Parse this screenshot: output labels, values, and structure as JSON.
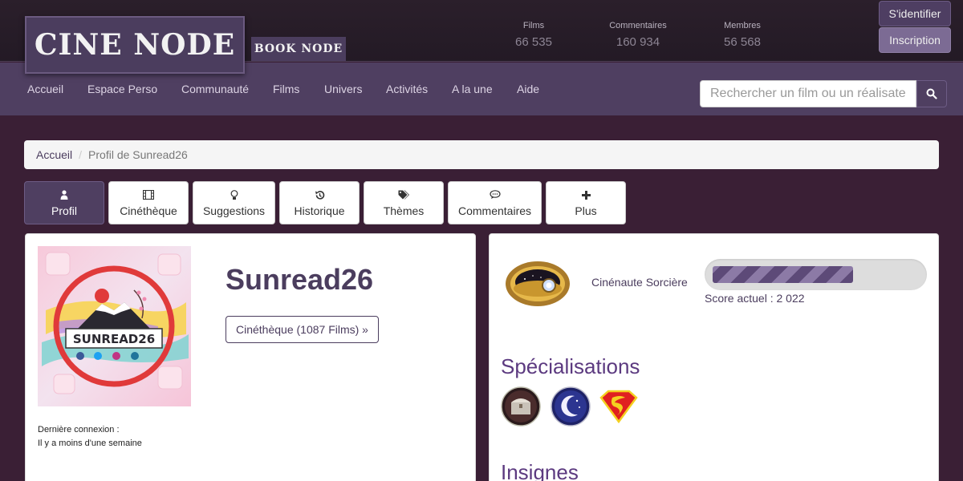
{
  "header": {
    "logo_main": "CINE NODE",
    "logo_secondary": "BOOK NODE",
    "stats": [
      {
        "label": "Films",
        "value": "66 535"
      },
      {
        "label": "Commentaires",
        "value": "160 934"
      },
      {
        "label": "Membres",
        "value": "56 568"
      }
    ],
    "login_label": "S'identifier",
    "signup_label": "Inscription"
  },
  "nav": {
    "items": [
      "Accueil",
      "Espace Perso",
      "Communauté",
      "Films",
      "Univers",
      "Activités",
      "A la une",
      "Aide"
    ],
    "search_placeholder": "Rechercher un film ou un réalisateur"
  },
  "breadcrumb": {
    "home": "Accueil",
    "current": "Profil de Sunread26"
  },
  "tabs": [
    {
      "label": "Profil",
      "icon": "user-icon"
    },
    {
      "label": "Cinéthèque",
      "icon": "film-icon"
    },
    {
      "label": "Suggestions",
      "icon": "lightbulb-icon"
    },
    {
      "label": "Historique",
      "icon": "history-icon"
    },
    {
      "label": "Thèmes",
      "icon": "tags-icon"
    },
    {
      "label": "Commentaires",
      "icon": "comment-icon"
    },
    {
      "label": "Plus",
      "icon": "plus-icon"
    }
  ],
  "profile": {
    "avatar_text": "SUNREAD26",
    "username": "Sunread26",
    "cinetheque_label": "Cinéthèque (1087 Films) »",
    "last_connection_label": "Dernière connexion :",
    "last_connection_value": "Il y a moins d'une semaine"
  },
  "rank": {
    "name": "Cinénaute Sorcière",
    "progress": 0.68,
    "score_label": "Score actuel : 2 022"
  },
  "specialisations": {
    "heading": "Spécialisations",
    "icons": [
      "treasure-chest-icon",
      "moon-icon",
      "superman-icon"
    ]
  },
  "insignes": {
    "heading": "Insignes"
  },
  "colors": {
    "accent": "#4f3f61",
    "heading_purple": "#5c3a80",
    "background": "#3a1f35"
  }
}
